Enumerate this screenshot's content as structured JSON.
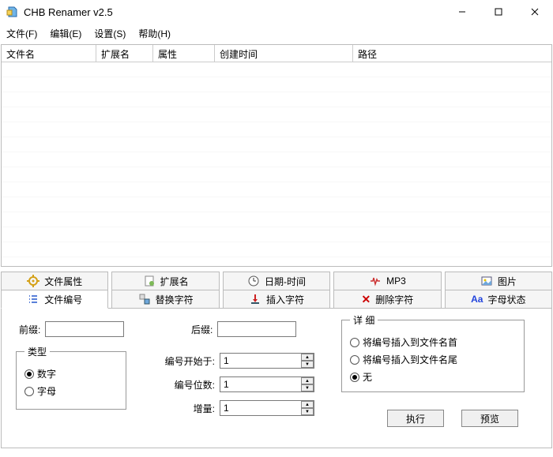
{
  "window": {
    "title": "CHB Renamer v2.5"
  },
  "menu": {
    "file": "文件(F)",
    "edit": "编辑(E)",
    "settings": "设置(S)",
    "help": "帮助(H)"
  },
  "table": {
    "columns": {
      "name": "文件名",
      "ext": "扩展名",
      "attr": "属性",
      "ctime": "创建时间",
      "path": "路径"
    }
  },
  "tabs_top": {
    "file_attr": "文件属性",
    "ext": "扩展名",
    "datetime": "日期-时间",
    "mp3": "MP3",
    "picture": "图片"
  },
  "tabs_bottom": {
    "numbering": "文件编号",
    "replace": "替换字符",
    "insert": "插入字符",
    "delete": "删除字符",
    "case": "字母状态"
  },
  "panel": {
    "prefix_label": "前缀:",
    "prefix_value": "",
    "suffix_label": "后缀:",
    "suffix_value": "",
    "type_legend": "类型",
    "type_number": "数字",
    "type_letter": "字母",
    "type_selected": "number",
    "start_label": "编号开始于:",
    "start_value": "1",
    "digits_label": "编号位数:",
    "digits_value": "1",
    "step_label": "增量:",
    "step_value": "1",
    "detail_legend": "详 细",
    "detail_head": "将编号插入到文件名首",
    "detail_tail": "将编号插入到文件名尾",
    "detail_none": "无",
    "detail_selected": "none",
    "execute": "执行",
    "preview": "预览"
  }
}
